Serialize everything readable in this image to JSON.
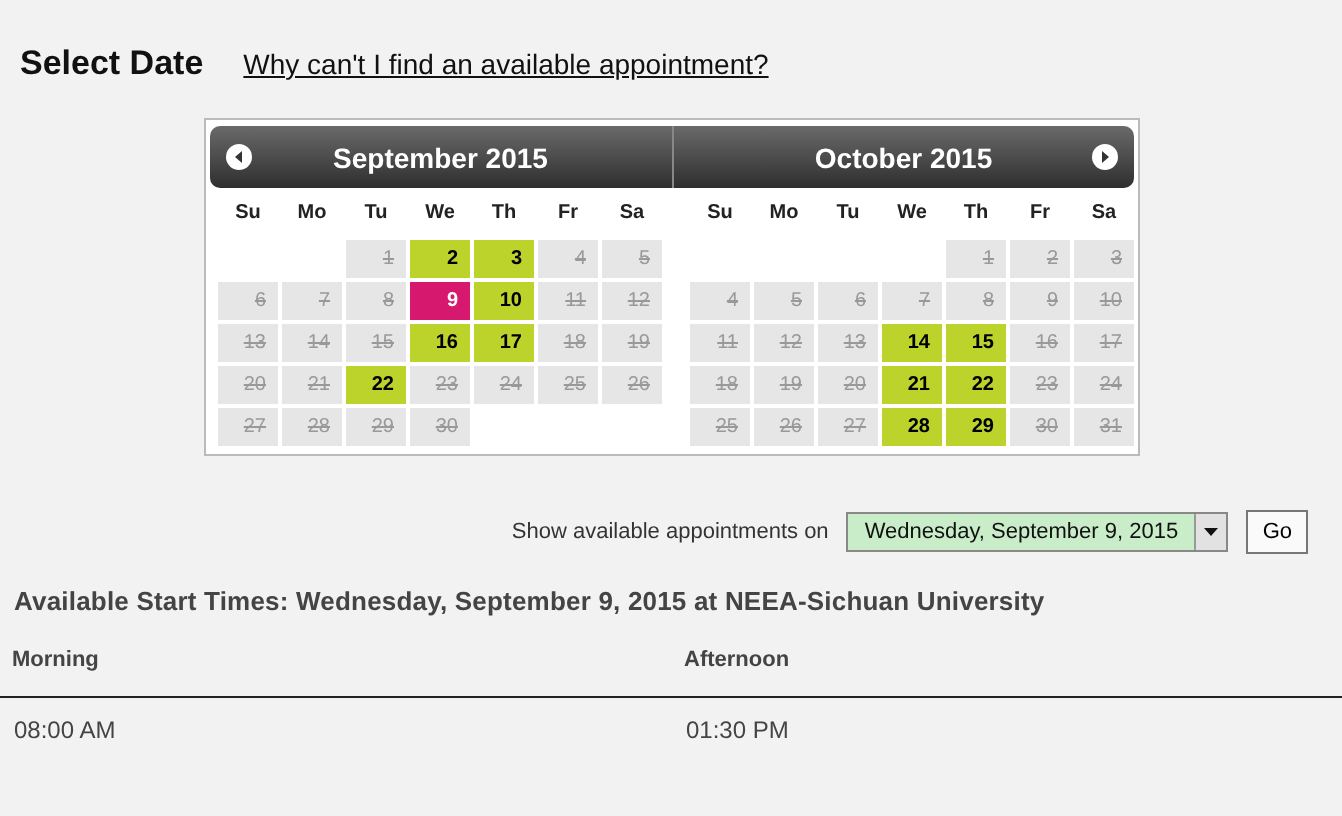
{
  "title": "Select Date",
  "help_link": "Why can't I find an available appointment?",
  "calendar": {
    "months": [
      {
        "title": "September 2015",
        "weekdays": [
          "Su",
          "Mo",
          "Tu",
          "We",
          "Th",
          "Fr",
          "Sa"
        ],
        "weeks": [
          [
            {
              "kind": "blank"
            },
            {
              "kind": "blank"
            },
            {
              "kind": "day",
              "label": "1",
              "available": false,
              "selected": false
            },
            {
              "kind": "day",
              "label": "2",
              "available": true,
              "selected": false
            },
            {
              "kind": "day",
              "label": "3",
              "available": true,
              "selected": false
            },
            {
              "kind": "day",
              "label": "4",
              "available": false,
              "selected": false
            },
            {
              "kind": "day",
              "label": "5",
              "available": false,
              "selected": false
            }
          ],
          [
            {
              "kind": "day",
              "label": "6",
              "available": false,
              "selected": false
            },
            {
              "kind": "day",
              "label": "7",
              "available": false,
              "selected": false
            },
            {
              "kind": "day",
              "label": "8",
              "available": false,
              "selected": false
            },
            {
              "kind": "day",
              "label": "9",
              "available": true,
              "selected": true
            },
            {
              "kind": "day",
              "label": "10",
              "available": true,
              "selected": false
            },
            {
              "kind": "day",
              "label": "11",
              "available": false,
              "selected": false
            },
            {
              "kind": "day",
              "label": "12",
              "available": false,
              "selected": false
            }
          ],
          [
            {
              "kind": "day",
              "label": "13",
              "available": false,
              "selected": false
            },
            {
              "kind": "day",
              "label": "14",
              "available": false,
              "selected": false
            },
            {
              "kind": "day",
              "label": "15",
              "available": false,
              "selected": false
            },
            {
              "kind": "day",
              "label": "16",
              "available": true,
              "selected": false
            },
            {
              "kind": "day",
              "label": "17",
              "available": true,
              "selected": false
            },
            {
              "kind": "day",
              "label": "18",
              "available": false,
              "selected": false
            },
            {
              "kind": "day",
              "label": "19",
              "available": false,
              "selected": false
            }
          ],
          [
            {
              "kind": "day",
              "label": "20",
              "available": false,
              "selected": false
            },
            {
              "kind": "day",
              "label": "21",
              "available": false,
              "selected": false
            },
            {
              "kind": "day",
              "label": "22",
              "available": true,
              "selected": false
            },
            {
              "kind": "day",
              "label": "23",
              "available": false,
              "selected": false
            },
            {
              "kind": "day",
              "label": "24",
              "available": false,
              "selected": false
            },
            {
              "kind": "day",
              "label": "25",
              "available": false,
              "selected": false
            },
            {
              "kind": "day",
              "label": "26",
              "available": false,
              "selected": false
            }
          ],
          [
            {
              "kind": "day",
              "label": "27",
              "available": false,
              "selected": false
            },
            {
              "kind": "day",
              "label": "28",
              "available": false,
              "selected": false
            },
            {
              "kind": "day",
              "label": "29",
              "available": false,
              "selected": false
            },
            {
              "kind": "day",
              "label": "30",
              "available": false,
              "selected": false
            },
            {
              "kind": "blank"
            },
            {
              "kind": "blank"
            },
            {
              "kind": "blank"
            }
          ]
        ]
      },
      {
        "title": "October 2015",
        "weekdays": [
          "Su",
          "Mo",
          "Tu",
          "We",
          "Th",
          "Fr",
          "Sa"
        ],
        "weeks": [
          [
            {
              "kind": "blank"
            },
            {
              "kind": "blank"
            },
            {
              "kind": "blank"
            },
            {
              "kind": "blank"
            },
            {
              "kind": "day",
              "label": "1",
              "available": false,
              "selected": false
            },
            {
              "kind": "day",
              "label": "2",
              "available": false,
              "selected": false
            },
            {
              "kind": "day",
              "label": "3",
              "available": false,
              "selected": false
            }
          ],
          [
            {
              "kind": "day",
              "label": "4",
              "available": false,
              "selected": false
            },
            {
              "kind": "day",
              "label": "5",
              "available": false,
              "selected": false
            },
            {
              "kind": "day",
              "label": "6",
              "available": false,
              "selected": false
            },
            {
              "kind": "day",
              "label": "7",
              "available": false,
              "selected": false
            },
            {
              "kind": "day",
              "label": "8",
              "available": false,
              "selected": false
            },
            {
              "kind": "day",
              "label": "9",
              "available": false,
              "selected": false
            },
            {
              "kind": "day",
              "label": "10",
              "available": false,
              "selected": false
            }
          ],
          [
            {
              "kind": "day",
              "label": "11",
              "available": false,
              "selected": false
            },
            {
              "kind": "day",
              "label": "12",
              "available": false,
              "selected": false
            },
            {
              "kind": "day",
              "label": "13",
              "available": false,
              "selected": false
            },
            {
              "kind": "day",
              "label": "14",
              "available": true,
              "selected": false
            },
            {
              "kind": "day",
              "label": "15",
              "available": true,
              "selected": false
            },
            {
              "kind": "day",
              "label": "16",
              "available": false,
              "selected": false
            },
            {
              "kind": "day",
              "label": "17",
              "available": false,
              "selected": false
            }
          ],
          [
            {
              "kind": "day",
              "label": "18",
              "available": false,
              "selected": false
            },
            {
              "kind": "day",
              "label": "19",
              "available": false,
              "selected": false
            },
            {
              "kind": "day",
              "label": "20",
              "available": false,
              "selected": false
            },
            {
              "kind": "day",
              "label": "21",
              "available": true,
              "selected": false
            },
            {
              "kind": "day",
              "label": "22",
              "available": true,
              "selected": false
            },
            {
              "kind": "day",
              "label": "23",
              "available": false,
              "selected": false
            },
            {
              "kind": "day",
              "label": "24",
              "available": false,
              "selected": false
            }
          ],
          [
            {
              "kind": "day",
              "label": "25",
              "available": false,
              "selected": false
            },
            {
              "kind": "day",
              "label": "26",
              "available": false,
              "selected": false
            },
            {
              "kind": "day",
              "label": "27",
              "available": false,
              "selected": false
            },
            {
              "kind": "day",
              "label": "28",
              "available": true,
              "selected": false
            },
            {
              "kind": "day",
              "label": "29",
              "available": true,
              "selected": false
            },
            {
              "kind": "day",
              "label": "30",
              "available": false,
              "selected": false
            },
            {
              "kind": "day",
              "label": "31",
              "available": false,
              "selected": false
            }
          ]
        ]
      }
    ]
  },
  "date_picker": {
    "label": "Show available appointments on",
    "value": "Wednesday, September 9, 2015",
    "button": "Go"
  },
  "results": {
    "heading": "Available Start Times: Wednesday, September 9, 2015 at NEEA-Sichuan University",
    "columns": [
      {
        "title": "Morning",
        "times": [
          "08:00 AM"
        ]
      },
      {
        "title": "Afternoon",
        "times": [
          "01:30 PM"
        ]
      }
    ]
  }
}
